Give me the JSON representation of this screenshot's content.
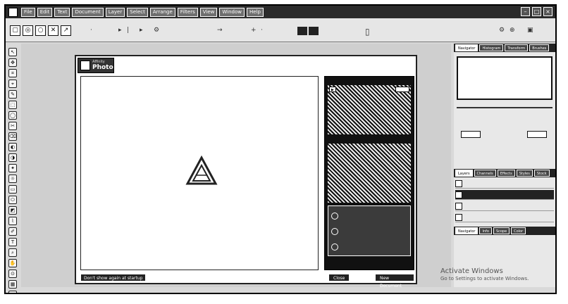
{
  "menubar": {
    "items": [
      "File",
      "Edit",
      "Text",
      "Document",
      "Layer",
      "Select",
      "Arrange",
      "Filters",
      "View",
      "Window",
      "Help"
    ],
    "window_controls": [
      "–",
      "□",
      "×"
    ]
  },
  "toolbar": {
    "dark_buttons": [
      "",
      ""
    ]
  },
  "tools_count": 24,
  "dialog": {
    "affinity_label": "Affinity",
    "product_label": "Photo",
    "sidebar_title": "",
    "footer_left": "Don't show again at startup",
    "close_label": "Close",
    "new_document_label": "New Document",
    "actions": [
      "",
      "",
      ""
    ]
  },
  "right_panel": {
    "top_tabs": [
      "Navigator",
      "Histogram",
      "Transform",
      "Brushes",
      "History"
    ],
    "layer_tabs": [
      "Layers",
      "Channels",
      "Effects",
      "Styles",
      "Stock"
    ],
    "bottom_tabs": [
      "Navigator",
      "Info",
      "Scope",
      "Color"
    ]
  },
  "watermark": {
    "line1": "Activate Windows",
    "line2": "Go to Settings to activate Windows."
  }
}
